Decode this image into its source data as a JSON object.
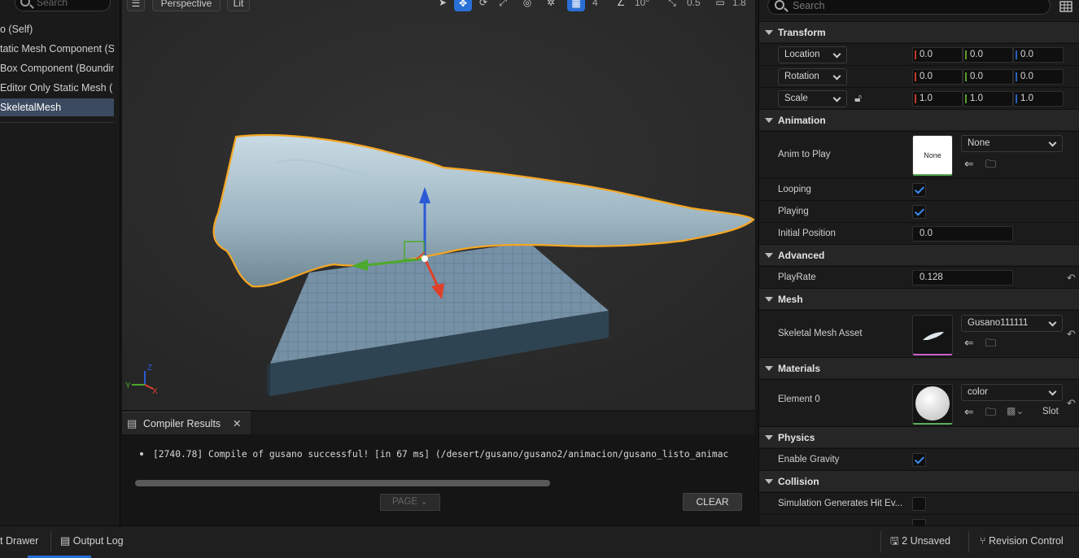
{
  "outliner": {
    "search_placeholder": "Search",
    "items": [
      {
        "label": "o (Self)"
      },
      {
        "label": "tatic Mesh Component (S"
      },
      {
        "label": "Box Component (Boundir"
      },
      {
        "label": "Editor Only Static Mesh ("
      },
      {
        "label": "SkeletalMesh",
        "selected": true
      }
    ]
  },
  "viewport": {
    "view_mode": "Perspective",
    "lighting": "Lit",
    "grid_size": "4",
    "rotation_snap": "10°",
    "scale_snap": "0.5",
    "camera_speed": "1.8",
    "axis_labels": {
      "x": "X",
      "y": "Y",
      "z": "Z"
    }
  },
  "compiler": {
    "tab_label": "Compiler Results",
    "log_line": "[2740.78] Compile of gusano successful! [in 67 ms] (/desert/gusano/gusano2/animacion/gusano_listo_animac",
    "page_button": "PAGE",
    "clear_button": "CLEAR"
  },
  "details": {
    "search_placeholder": "Search",
    "transform": {
      "header": "Transform",
      "location_label": "Location",
      "rotation_label": "Rotation",
      "scale_label": "Scale",
      "location": [
        "0.0",
        "0.0",
        "0.0"
      ],
      "rotation": [
        "0.0",
        "0.0",
        "0.0"
      ],
      "scale": [
        "1.0",
        "1.0",
        "1.0"
      ]
    },
    "animation": {
      "header": "Animation",
      "anim_to_play_label": "Anim to Play",
      "anim_thumb_text": "None",
      "anim_value": "None",
      "looping_label": "Looping",
      "looping": true,
      "playing_label": "Playing",
      "playing": true,
      "initial_position_label": "Initial Position",
      "initial_position": "0.0"
    },
    "advanced": {
      "header": "Advanced",
      "playrate_label": "PlayRate",
      "playrate": "0.128"
    },
    "mesh": {
      "header": "Mesh",
      "asset_label": "Skeletal Mesh Asset",
      "asset_value": "Gusano111111"
    },
    "materials": {
      "header": "Materials",
      "element_label": "Element 0",
      "element_value": "color",
      "slot_label": "Slot"
    },
    "physics": {
      "header": "Physics",
      "gravity_label": "Enable Gravity",
      "gravity": true
    },
    "collision": {
      "header": "Collision",
      "hit_events_label": "Simulation Generates Hit Ev...",
      "hit_events": false
    }
  },
  "statusbar": {
    "content_drawer": "t Drawer",
    "output_log": "Output Log",
    "unsaved": "2 Unsaved",
    "revision_control": "Revision Control"
  },
  "colors": {
    "selection_outline": "#f5a623",
    "accent_blue": "#2a6fd6",
    "axis_x": "#e0402a",
    "axis_y": "#4caa2c",
    "axis_z": "#2a5ad6"
  }
}
